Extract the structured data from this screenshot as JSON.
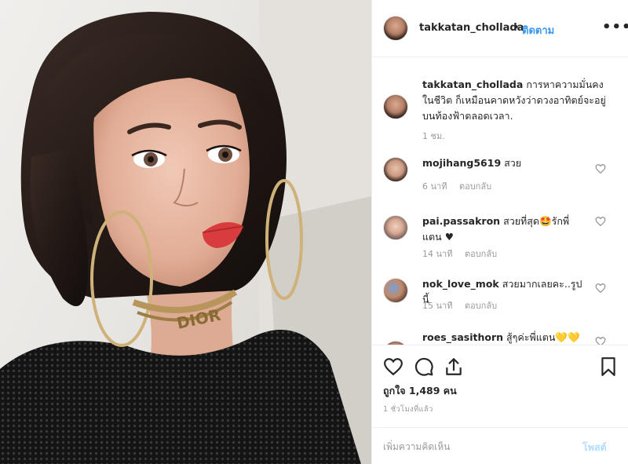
{
  "post": {
    "username": "takkatan_chollada",
    "dot": "•",
    "follow_label": "ติดตาม",
    "more_label": "•••",
    "caption_user": "takkatan_chollada",
    "caption_text": "การหาความมั่นคงในชีวิต ก็เหมือนคาดหวังว่าดวงอาทิตย์จะอยู่บนท้องฟ้าตลอดเวลา.",
    "caption_time": "1 ชม."
  },
  "photo": {
    "necklace_text": "DIOR"
  },
  "comments": [
    {
      "user": "mojihang5619",
      "text": "สวย",
      "time": "6 นาที",
      "reply": "ตอบกลับ"
    },
    {
      "user": "pai.passakron",
      "text": "สวยที่สุด🤩รักพี่แตน ♥",
      "time": "14 นาที",
      "reply": "ตอบกลับ"
    },
    {
      "user": "nok_love_mok",
      "text": "สวยมากเลยคะ..รูปนี้",
      "time": "15 นาที",
      "reply": "ตอบกลับ"
    },
    {
      "user": "roes_sasithorn",
      "text": "สู้ๆค่ะพี่แตน💛💛",
      "time": "",
      "reply": ""
    }
  ],
  "actions": {
    "icons": [
      "heart-icon",
      "comment-icon",
      "share-icon",
      "bookmark-icon"
    ],
    "likes": "ถูกใจ 1,489 คน",
    "posted_time": "1 ชั่วโมงที่แล้ว"
  },
  "add_comment": {
    "placeholder": "เพิ่มความคิดเห็น",
    "post_label": "โพสต์"
  },
  "colors": {
    "link_blue": "#3897f0",
    "post_disabled": "#b3dbff",
    "meta_gray": "#999999"
  }
}
